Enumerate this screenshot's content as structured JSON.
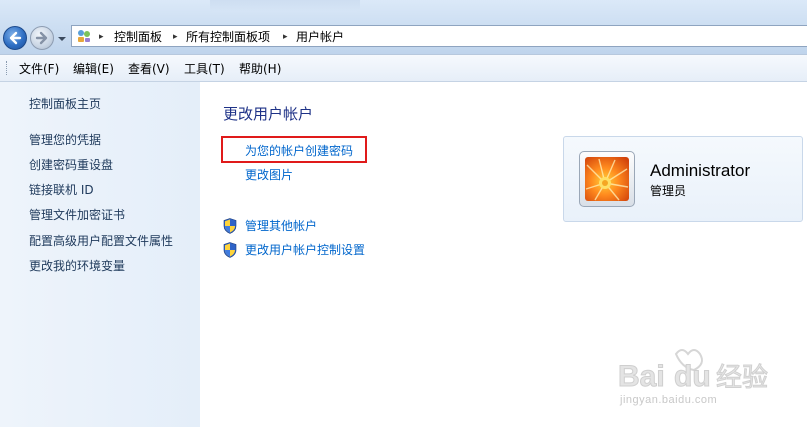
{
  "address_bar": {
    "breadcrumbs": [
      "控制面板",
      "所有控制面板项",
      "用户帐户"
    ],
    "icon": "control-panel-icon"
  },
  "menu": {
    "items": [
      "文件(F)",
      "编辑(E)",
      "查看(V)",
      "工具(T)",
      "帮助(H)"
    ]
  },
  "sidebar": {
    "items": [
      "控制面板主页",
      "管理您的凭据",
      "创建密码重设盘",
      "链接联机 ID",
      "管理文件加密证书",
      "配置高级用户配置文件属性",
      "更改我的环境变量"
    ]
  },
  "main": {
    "title": "更改用户帐户",
    "tasks": [
      "为您的帐户创建密码",
      "更改图片"
    ],
    "admin_tasks": [
      "管理其他帐户",
      "更改用户帐户控制设置"
    ],
    "highlight_color": "#e01a1a"
  },
  "account": {
    "name": "Administrator",
    "role": "管理员"
  },
  "watermark": {
    "logo": "Baidu经验",
    "url": "jingyan.baidu.com"
  }
}
